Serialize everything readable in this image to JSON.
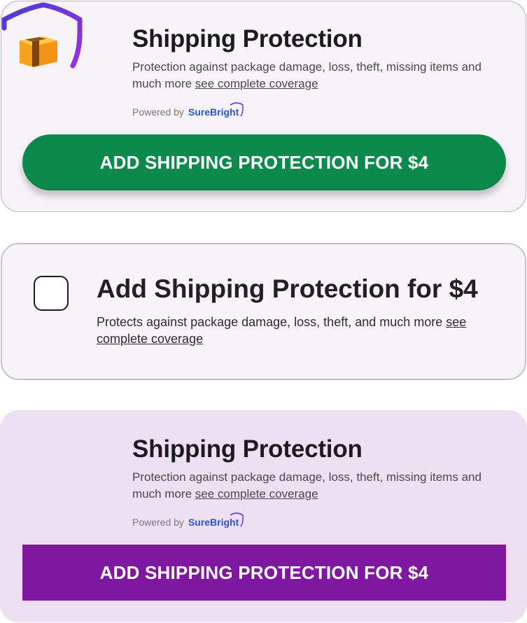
{
  "card_one": {
    "title": "Shipping Protection",
    "description": "Protection against package damage, loss, theft, missing items and much more",
    "coverage_link": "see complete coverage",
    "powered_by_label": "Powered by",
    "brand_name": "SureBright",
    "button_label": "ADD SHIPPING PROTECTION FOR $4",
    "button_color": "#0b8a4c"
  },
  "card_two": {
    "checkbox_checked": false,
    "title": "Add Shipping Protection for $4",
    "description": "Protects against package damage, loss, theft, and much more",
    "coverage_link": "see complete coverage"
  },
  "card_three": {
    "background_color": "#efdff3",
    "title": "Shipping Protection",
    "description": "Protection against package damage, loss, theft, missing items and much more",
    "coverage_link": "see complete coverage",
    "powered_by_label": "Powered by",
    "brand_name": "SureBright",
    "button_label": "ADD SHIPPING PROTECTION FOR $4",
    "button_color": "#7f17a0"
  },
  "icons": {
    "logo": "shield-box-icon",
    "brand_mark": "surebright-arc-icon"
  },
  "colors": {
    "shield_gradient_start": "#4b3bd1",
    "shield_gradient_end": "#8a2ee0",
    "box_orange": "#f6a623"
  }
}
